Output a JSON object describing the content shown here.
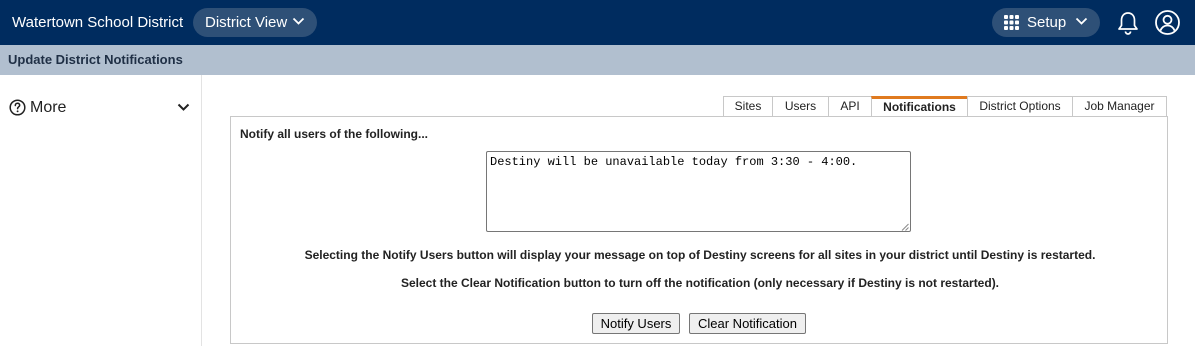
{
  "topbar": {
    "district_name": "Watertown School District",
    "view_label": "District View",
    "setup_label": "Setup",
    "bg_color": "#002c5f",
    "pill_color": "#2e5077"
  },
  "icons": {
    "view_chevron": "chevron-down-icon",
    "setup_grid": "apps-grid-icon",
    "setup_chevron": "chevron-down-icon",
    "notifications": "bell-icon",
    "account": "user-account-icon",
    "help": "question-circle-icon",
    "more_chevron": "chevron-down-icon"
  },
  "page": {
    "title": "Update District Notifications"
  },
  "sidebar": {
    "more_label": "More"
  },
  "tabs": [
    {
      "label": "Sites",
      "active": false
    },
    {
      "label": "Users",
      "active": false
    },
    {
      "label": "API",
      "active": false
    },
    {
      "label": "Notifications",
      "active": true
    },
    {
      "label": "District Options",
      "active": false
    },
    {
      "label": "Job Manager",
      "active": false
    }
  ],
  "tab_accent_color": "#e07a1f",
  "panel": {
    "heading": "Notify all users of the following...",
    "message": "Destiny will be unavailable today from 3:30 - 4:00.",
    "info_line_1": "Selecting the Notify Users button will display your message on top of Destiny screens for all sites in your district until Destiny is restarted.",
    "info_line_2": "Select the Clear Notification button to turn off the notification (only necessary if Destiny is not restarted).",
    "notify_button": "Notify Users",
    "clear_button": "Clear Notification"
  }
}
